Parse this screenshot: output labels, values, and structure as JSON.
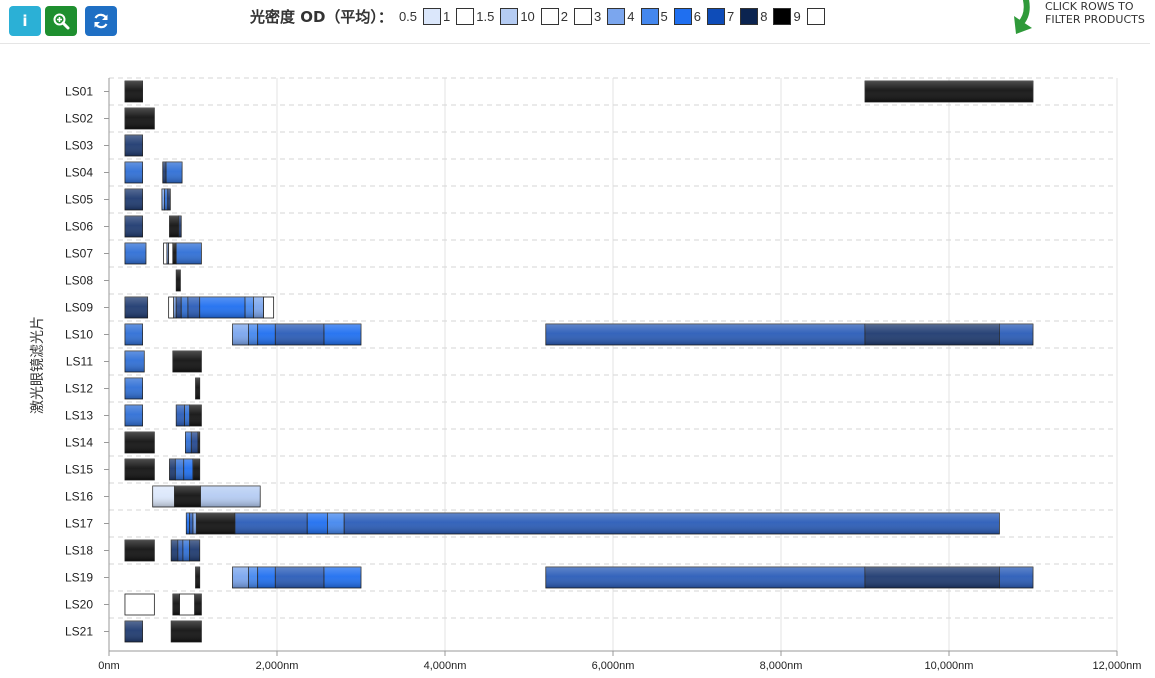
{
  "toolbar": {
    "info_glyph": "i",
    "buttons": [
      {
        "name": "info-button",
        "icon": "info-icon"
      },
      {
        "name": "zoom-button",
        "icon": "zoom-in-icon"
      },
      {
        "name": "refresh-button",
        "icon": "refresh-icon"
      }
    ]
  },
  "legend": {
    "title": "光密度 OD（平均）：",
    "items": [
      {
        "label": "0.5",
        "color": "#dbe7fb",
        "grad": false
      },
      {
        "label": "1",
        "color": "#ffffff",
        "grad": false
      },
      {
        "label": "1.5",
        "color": "#b5ccf3",
        "grad": false
      },
      {
        "label": "10",
        "color": "#ffffff",
        "grad": false
      },
      {
        "label": "2",
        "color": "#ffffff",
        "grad": false
      },
      {
        "label": "3",
        "color": "#7ba6ee",
        "grad": false
      },
      {
        "label": "4",
        "color": "#4487ee",
        "grad": false
      },
      {
        "label": "5",
        "color": "#1f6ff0",
        "grad": false
      },
      {
        "label": "6",
        "color": "#0e4cb8",
        "grad": false
      },
      {
        "label": "7",
        "color": "#0b2450",
        "grad": false
      },
      {
        "label": "8",
        "color": "#000000",
        "grad": false
      },
      {
        "label": "9",
        "color": "#ffffff",
        "grad": false
      }
    ]
  },
  "hint": {
    "line1": "CLICK ROWS TO",
    "line2": "FILTER PRODUCTS",
    "arrow_color": "#2f9a3a"
  },
  "chart_data": {
    "type": "bar",
    "subtype": "horizontal-range-gantt",
    "ylabel": "激光眼镜滤光片",
    "xlim": [
      0,
      12000
    ],
    "xticks": [
      0,
      2000,
      4000,
      6000,
      8000,
      10000,
      12000
    ],
    "xtick_labels": [
      "0nm",
      "2,000nm",
      "4,000nm",
      "6,000nm",
      "8,000nm",
      "10,000nm",
      "12,000nm"
    ],
    "grid": true,
    "od_colors": {
      "2": "#ffffff",
      "0.5": "#dbe7fb",
      "1.5": "#b5ccf3",
      "3": "#7ba6ee",
      "4": "#4487ee",
      "4b": "#2f6fd6",
      "5": "#1f6ff0",
      "6": "#2a5cb8",
      "6d": "#24488f",
      "7": "#1e3a70",
      "8": "#111111"
    },
    "categories": [
      "LS01",
      "LS02",
      "LS03",
      "LS04",
      "LS05",
      "LS06",
      "LS07",
      "LS08",
      "LS09",
      "LS10",
      "LS11",
      "LS12",
      "LS13",
      "LS14",
      "LS15",
      "LS16",
      "LS17",
      "LS18",
      "LS19",
      "LS20",
      "LS21"
    ],
    "rows": [
      {
        "name": "LS01",
        "segments": [
          [
            190,
            400,
            "8"
          ],
          [
            9000,
            11000,
            "8"
          ]
        ]
      },
      {
        "name": "LS02",
        "segments": [
          [
            190,
            540,
            "8"
          ]
        ]
      },
      {
        "name": "LS03",
        "segments": [
          [
            190,
            400,
            "7"
          ]
        ]
      },
      {
        "name": "LS04",
        "segments": [
          [
            190,
            400,
            "4b"
          ],
          [
            640,
            680,
            "7"
          ],
          [
            680,
            870,
            "4b"
          ]
        ]
      },
      {
        "name": "LS05",
        "segments": [
          [
            190,
            400,
            "7"
          ],
          [
            630,
            660,
            "3"
          ],
          [
            660,
            700,
            "4b"
          ],
          [
            700,
            730,
            "7"
          ]
        ]
      },
      {
        "name": "LS06",
        "segments": [
          [
            190,
            400,
            "7"
          ],
          [
            720,
            830,
            "8"
          ],
          [
            830,
            860,
            "7"
          ]
        ]
      },
      {
        "name": "LS07",
        "segments": [
          [
            190,
            440,
            "4b"
          ],
          [
            650,
            690,
            "2"
          ],
          [
            690,
            710,
            "3"
          ],
          [
            710,
            760,
            "2"
          ],
          [
            760,
            800,
            "8"
          ],
          [
            800,
            1100,
            "4b"
          ]
        ]
      },
      {
        "name": "LS08",
        "segments": [
          [
            800,
            850,
            "8"
          ]
        ]
      },
      {
        "name": "LS09",
        "segments": [
          [
            190,
            460,
            "7"
          ],
          [
            710,
            770,
            "2"
          ],
          [
            770,
            800,
            "3"
          ],
          [
            800,
            860,
            "6d"
          ],
          [
            860,
            940,
            "4b"
          ],
          [
            940,
            1080,
            "6"
          ],
          [
            1080,
            1620,
            "5"
          ],
          [
            1620,
            1720,
            "4"
          ],
          [
            1720,
            1840,
            "3"
          ],
          [
            1840,
            1960,
            "2"
          ]
        ]
      },
      {
        "name": "LS10",
        "segments": [
          [
            190,
            400,
            "4b"
          ],
          [
            1470,
            1660,
            "3"
          ],
          [
            1660,
            1770,
            "4"
          ],
          [
            1770,
            1980,
            "5"
          ],
          [
            1980,
            2560,
            "6"
          ],
          [
            2560,
            3000,
            "5"
          ],
          [
            5200,
            9000,
            "6"
          ],
          [
            9000,
            10600,
            "7"
          ],
          [
            10600,
            11000,
            "6"
          ]
        ]
      },
      {
        "name": "LS11",
        "segments": [
          [
            190,
            420,
            "4b"
          ],
          [
            760,
            1100,
            "8"
          ]
        ]
      },
      {
        "name": "LS12",
        "segments": [
          [
            190,
            400,
            "4b"
          ],
          [
            1030,
            1080,
            "8"
          ]
        ]
      },
      {
        "name": "LS13",
        "segments": [
          [
            190,
            400,
            "4b"
          ],
          [
            800,
            900,
            "6"
          ],
          [
            900,
            960,
            "4b"
          ],
          [
            960,
            1100,
            "8"
          ]
        ]
      },
      {
        "name": "LS14",
        "segments": [
          [
            190,
            540,
            "8"
          ],
          [
            910,
            980,
            "4b"
          ],
          [
            980,
            1060,
            "6d"
          ],
          [
            1060,
            1080,
            "8"
          ]
        ]
      },
      {
        "name": "LS15",
        "segments": [
          [
            190,
            540,
            "8"
          ],
          [
            720,
            790,
            "7"
          ],
          [
            790,
            890,
            "4b"
          ],
          [
            890,
            1000,
            "5"
          ],
          [
            1000,
            1080,
            "8"
          ]
        ]
      },
      {
        "name": "LS16",
        "segments": [
          [
            520,
            780,
            "0.5"
          ],
          [
            780,
            1090,
            "8"
          ],
          [
            1090,
            1800,
            "1.5"
          ]
        ]
      },
      {
        "name": "LS17",
        "segments": [
          [
            920,
            960,
            "5"
          ],
          [
            960,
            1000,
            "6"
          ],
          [
            1000,
            1040,
            "3"
          ],
          [
            1040,
            1500,
            "8"
          ],
          [
            1500,
            2360,
            "6"
          ],
          [
            2360,
            2600,
            "5"
          ],
          [
            2600,
            2800,
            "4"
          ],
          [
            2800,
            10600,
            "6"
          ]
        ]
      },
      {
        "name": "LS18",
        "segments": [
          [
            190,
            540,
            "8"
          ],
          [
            740,
            820,
            "7"
          ],
          [
            820,
            880,
            "6"
          ],
          [
            880,
            960,
            "4b"
          ],
          [
            960,
            1080,
            "7"
          ]
        ]
      },
      {
        "name": "LS19",
        "segments": [
          [
            1030,
            1080,
            "8"
          ],
          [
            1470,
            1660,
            "3"
          ],
          [
            1660,
            1770,
            "4"
          ],
          [
            1770,
            1980,
            "5"
          ],
          [
            1980,
            2560,
            "6"
          ],
          [
            2560,
            3000,
            "5"
          ],
          [
            5200,
            9000,
            "6"
          ],
          [
            9000,
            10600,
            "7"
          ],
          [
            10600,
            11000,
            "6"
          ]
        ]
      },
      {
        "name": "LS20",
        "segments": [
          [
            190,
            540,
            "2"
          ],
          [
            760,
            840,
            "8"
          ],
          [
            840,
            1020,
            "2"
          ],
          [
            1020,
            1100,
            "8"
          ]
        ]
      },
      {
        "name": "LS21",
        "segments": [
          [
            190,
            400,
            "7"
          ],
          [
            740,
            1100,
            "8"
          ]
        ]
      }
    ]
  }
}
